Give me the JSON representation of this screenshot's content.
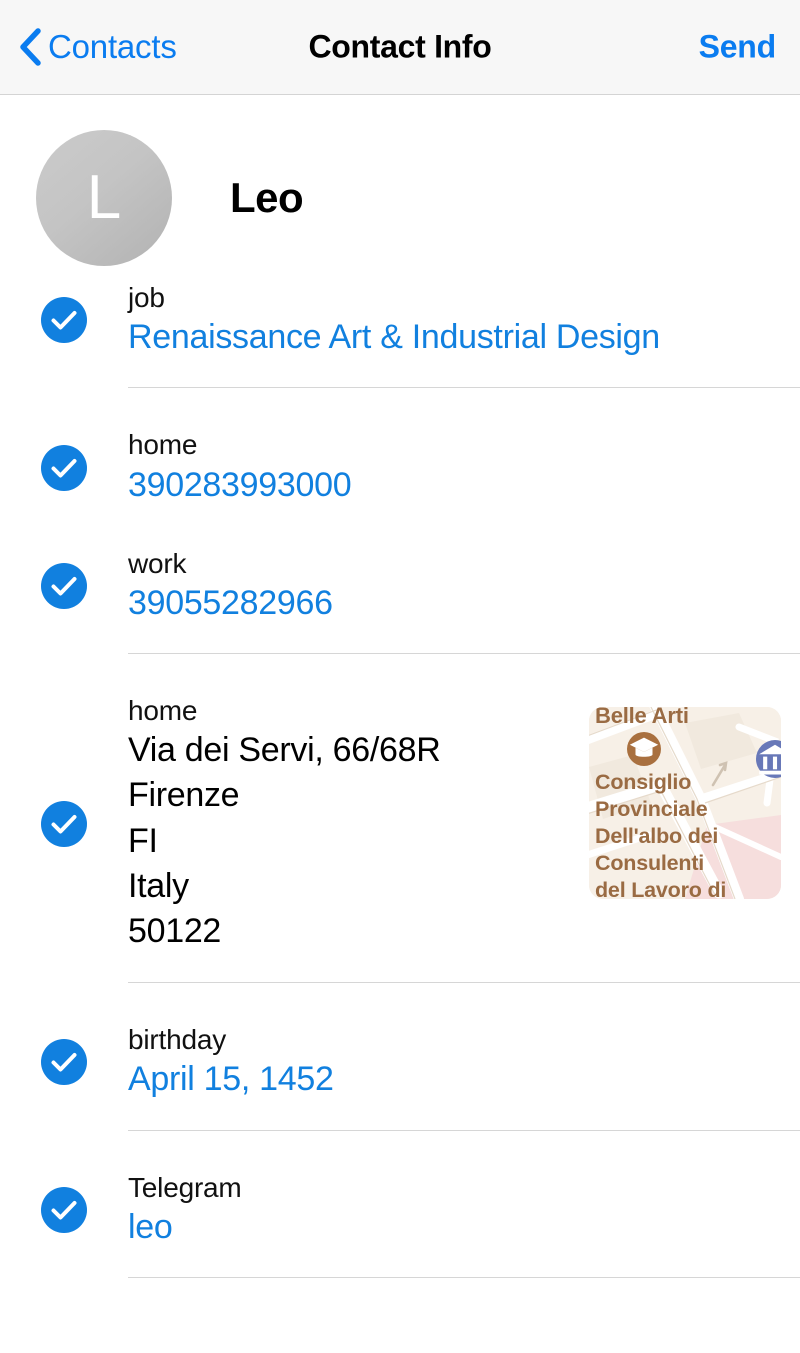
{
  "navbar": {
    "back_label": "Contacts",
    "back_icon": "chevron-left-icon",
    "title": "Contact Info",
    "action_label": "Send"
  },
  "contact": {
    "avatar_initial": "L",
    "name": "Leo",
    "avatar_color_start": "#cbcbcb",
    "avatar_color_end": "#b2b2b2"
  },
  "theme": {
    "accent": "#1180df",
    "link": "#1180df",
    "nav_tint": "#0a7cf0",
    "navbar_bg": "#f7f7f7",
    "divider": "#d6d6d6",
    "text": "#000000"
  },
  "fields": [
    {
      "id": "job",
      "label": "job",
      "value": "Renaissance Art & Industrial Design",
      "value_style": "link",
      "checked": true,
      "check_icon": "check-circle-icon"
    },
    {
      "id": "phone-home",
      "label": "home",
      "value": "390283993000",
      "value_style": "link",
      "checked": true,
      "check_icon": "check-circle-icon"
    },
    {
      "id": "phone-work",
      "label": "work",
      "value": "39055282966",
      "value_style": "link",
      "checked": true,
      "check_icon": "check-circle-icon"
    },
    {
      "id": "address-home",
      "label": "home",
      "value_style": "plain",
      "checked": true,
      "check_icon": "check-circle-icon",
      "address_lines": [
        "Via dei Servi, 66/68R",
        "Firenze",
        "FI",
        "Italy",
        "50122"
      ]
    },
    {
      "id": "birthday",
      "label": "birthday",
      "value": "April 15, 1452",
      "value_style": "link",
      "checked": true,
      "check_icon": "check-circle-icon"
    },
    {
      "id": "telegram",
      "label": "Telegram",
      "value": "leo",
      "value_style": "link",
      "checked": true,
      "check_icon": "check-circle-icon"
    }
  ],
  "map": {
    "label_top": "Belle Arti",
    "label_main_line1": "Consiglio",
    "label_main_line2": "Provinciale",
    "label_main_line3": "Dell'albo dei",
    "label_main_line4": "Consulenti",
    "label_main_line5": "del Lavoro di",
    "poi_education_icon": "graduation-cap-icon",
    "poi_museum_icon": "museum-icon",
    "background_color": "#f6efe6",
    "label_color": "#9a6b43"
  }
}
